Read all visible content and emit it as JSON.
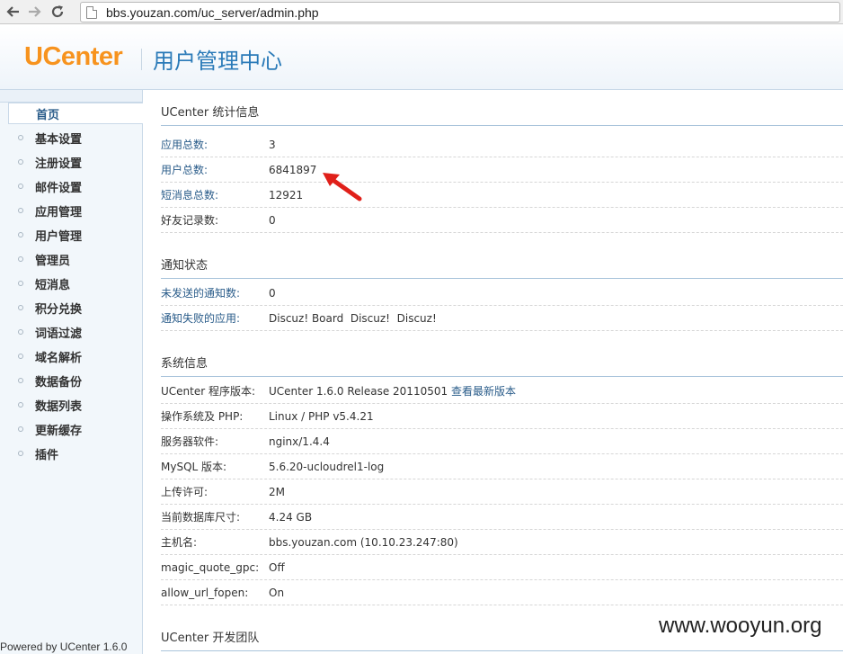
{
  "browser": {
    "url": "bbs.youzan.com/uc_server/admin.php"
  },
  "header": {
    "logo": "UCenter",
    "title": "用户管理中心"
  },
  "sidebar": {
    "items": [
      {
        "label": "首页",
        "active": true
      },
      {
        "label": "基本设置"
      },
      {
        "label": "注册设置"
      },
      {
        "label": "邮件设置"
      },
      {
        "label": "应用管理"
      },
      {
        "label": "用户管理"
      },
      {
        "label": "管理员"
      },
      {
        "label": "短消息"
      },
      {
        "label": "积分兑换"
      },
      {
        "label": "词语过滤"
      },
      {
        "label": "域名解析"
      },
      {
        "label": "数据备份"
      },
      {
        "label": "数据列表"
      },
      {
        "label": "更新缓存"
      },
      {
        "label": "插件"
      }
    ],
    "powered": "Powered by UCenter 1.6.0"
  },
  "stats": {
    "title": "UCenter 统计信息",
    "rows": [
      {
        "k": "应用总数:",
        "v": "3"
      },
      {
        "k": "用户总数:",
        "v": "6841897"
      },
      {
        "k": "短消息总数:",
        "v": "12921"
      },
      {
        "k": "好友记录数:",
        "v": "0"
      }
    ]
  },
  "notify": {
    "title": "通知状态",
    "rows": [
      {
        "k": "未发送的通知数:",
        "v": "0"
      },
      {
        "k": "通知失败的应用:",
        "v": "Discuz! Board  Discuz!  Discuz!"
      }
    ]
  },
  "system": {
    "title": "系统信息",
    "rows": [
      {
        "k": "UCenter 程序版本:",
        "v": "UCenter 1.6.0 Release 20110501",
        "link": "查看最新版本"
      },
      {
        "k": "操作系统及 PHP:",
        "v": "Linux / PHP v5.4.21"
      },
      {
        "k": "服务器软件:",
        "v": "nginx/1.4.4"
      },
      {
        "k": "MySQL 版本:",
        "v": "5.6.20-ucloudrel1-log"
      },
      {
        "k": "上传许可:",
        "v": "2M"
      },
      {
        "k": "当前数据库尺寸:",
        "v": "4.24 GB"
      },
      {
        "k": "主机名:",
        "v": "bbs.youzan.com (10.10.23.247:80)"
      },
      {
        "k": "magic_quote_gpc:",
        "v": "Off"
      },
      {
        "k": "allow_url_fopen:",
        "v": "On"
      }
    ]
  },
  "team": {
    "title": "UCenter 开发团队"
  },
  "watermark": "www.wooyun.org",
  "colors": {
    "brand_orange": "#f7931e",
    "title_blue": "#2a7ab8",
    "link_blue": "#2a5c8a",
    "arrow_red": "#e0201a"
  },
  "icons": [
    "back-arrow-icon",
    "forward-arrow-icon",
    "reload-icon",
    "page-icon",
    "red-arrow-annotation"
  ]
}
